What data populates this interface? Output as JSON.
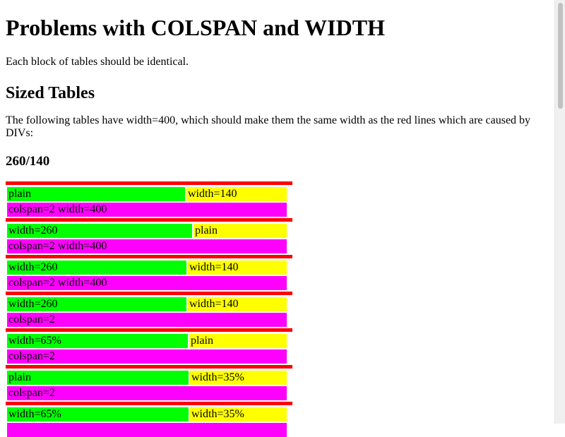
{
  "heading": "Problems with COLSPAN and WIDTH",
  "intro": "Each block of tables should be identical.",
  "section_title": "Sized Tables",
  "description": "The following tables have width=400, which should make them the same width as the red lines which are caused by DIVs:",
  "subsection_title": "260/140",
  "tables": [
    {
      "left": "plain",
      "right": "width=140",
      "bottom": "colspan=2 width=400"
    },
    {
      "left": "width=260",
      "right": "plain",
      "bottom": "colspan=2 width=400"
    },
    {
      "left": "width=260",
      "right": "width=140",
      "bottom": "colspan=2 width=400"
    },
    {
      "left": "width=260",
      "right": "width=140",
      "bottom": "colspan=2"
    },
    {
      "left": "width=65%",
      "right": "plain",
      "bottom": "colspan=2"
    },
    {
      "left": "plain",
      "right": "width=35%",
      "bottom": "colspan=2"
    },
    {
      "left": "width=65%",
      "right": "width=35%",
      "bottom": ""
    }
  ],
  "colors": {
    "red": "#ff0000",
    "green": "#00ff00",
    "yellow": "#ffff00",
    "magenta": "#ff00ff"
  }
}
